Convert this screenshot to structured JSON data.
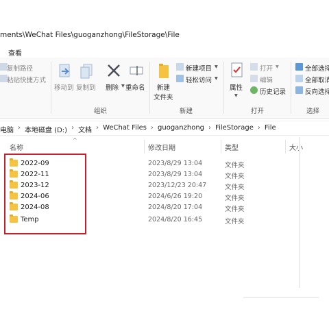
{
  "window": {
    "title": "ments\\WeChat Files\\guoganzhong\\FileStorage\\File"
  },
  "menu": {
    "view": "查看"
  },
  "ribbon": {
    "copy_path": "复制路径",
    "paste_shortcut": "粘贴快捷方式",
    "move_to": "移动到",
    "copy_to": "复制到",
    "delete": "删除",
    "rename": "重命名",
    "organize_group": "组织",
    "new_folder_line1": "新建",
    "new_folder_line2": "文件夹",
    "new_item": "新建项目",
    "easy_access": "轻松访问",
    "new_group": "新建",
    "properties": "属性",
    "open": "打开",
    "edit": "编辑",
    "history": "历史记录",
    "open_group": "打开",
    "select_all": "全部选择",
    "select_none": "全部取消",
    "invert_selection": "反向选择",
    "select_group": "选择"
  },
  "breadcrumb": [
    "电脑",
    "本地磁盘 (D:)",
    "文档",
    "WeChat Files",
    "guoganzhong",
    "FileStorage",
    "File"
  ],
  "columns": {
    "name": "名称",
    "modified": "修改日期",
    "type": "类型",
    "size": "大小"
  },
  "files": [
    {
      "name": "2022-09",
      "modified": "2023/8/29 13:04",
      "type": "文件夹"
    },
    {
      "name": "2022-11",
      "modified": "2023/8/29 13:04",
      "type": "文件夹"
    },
    {
      "name": "2023-12",
      "modified": "2023/12/23 20:47",
      "type": "文件夹"
    },
    {
      "name": "2024-06",
      "modified": "2024/6/26 19:20",
      "type": "文件夹"
    },
    {
      "name": "2024-08",
      "modified": "2024/8/20 17:04",
      "type": "文件夹"
    },
    {
      "name": "Temp",
      "modified": "2024/8/20 16:45",
      "type": "文件夹"
    }
  ],
  "colors": {
    "folder": "#f5c242",
    "highlight": "#c8202a",
    "accent": "#1a73c9"
  }
}
